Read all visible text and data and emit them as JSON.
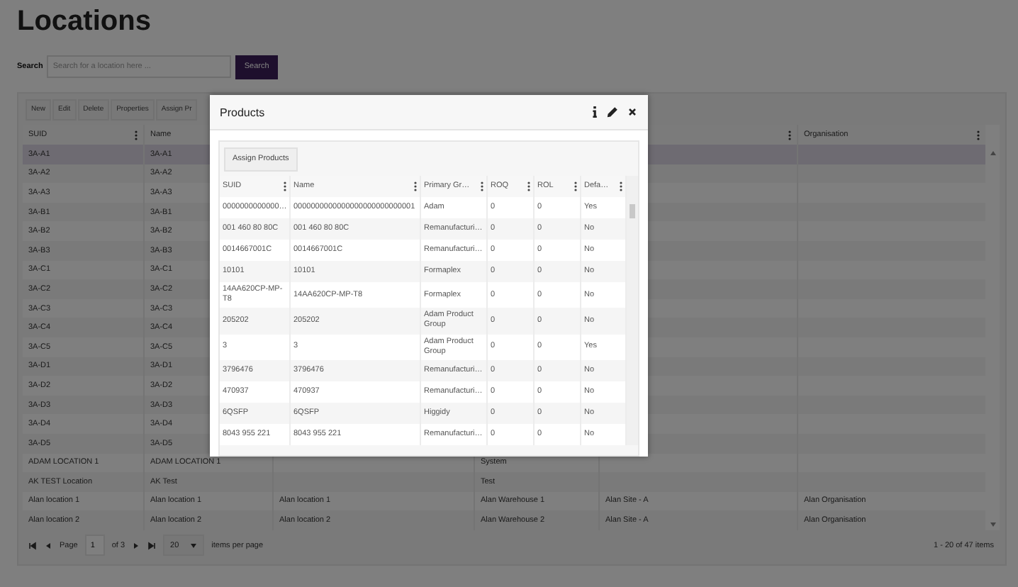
{
  "page": {
    "title": "Locations"
  },
  "search": {
    "label": "Search",
    "placeholder": "Search for a location here ...",
    "button": "Search"
  },
  "toolbar": [
    "New",
    "Edit",
    "Delete",
    "Properties",
    "Assign Pr"
  ],
  "grid": {
    "columns": [
      {
        "label": "SUID",
        "menu": true
      },
      {
        "label": "Name"
      },
      {},
      {},
      {
        "menu": true
      },
      {
        "label": "Organisation",
        "menu": true
      }
    ],
    "rows": [
      {
        "selected": true,
        "cells": [
          "3A-A1",
          "3A-A1",
          null,
          null,
          null,
          null
        ]
      },
      {
        "selected": false,
        "cells": [
          "3A-A2",
          "3A-A2",
          null,
          null,
          null,
          null
        ]
      },
      {
        "selected": false,
        "cells": [
          "3A-A3",
          "3A-A3",
          null,
          null,
          null,
          null
        ]
      },
      {
        "selected": false,
        "cells": [
          "3A-B1",
          "3A-B1",
          null,
          null,
          null,
          null
        ]
      },
      {
        "selected": false,
        "cells": [
          "3A-B2",
          "3A-B2",
          null,
          null,
          null,
          null
        ]
      },
      {
        "selected": false,
        "cells": [
          "3A-B3",
          "3A-B3",
          null,
          null,
          null,
          null
        ]
      },
      {
        "selected": false,
        "cells": [
          "3A-C1",
          "3A-C1",
          null,
          null,
          null,
          null
        ]
      },
      {
        "selected": false,
        "cells": [
          "3A-C2",
          "3A-C2",
          null,
          null,
          null,
          null
        ]
      },
      {
        "selected": false,
        "cells": [
          "3A-C3",
          "3A-C3",
          null,
          null,
          null,
          null
        ]
      },
      {
        "selected": false,
        "cells": [
          "3A-C4",
          "3A-C4",
          null,
          null,
          null,
          null
        ]
      },
      {
        "selected": false,
        "cells": [
          "3A-C5",
          "3A-C5",
          null,
          null,
          null,
          null
        ]
      },
      {
        "selected": false,
        "cells": [
          "3A-D1",
          "3A-D1",
          null,
          null,
          null,
          null
        ]
      },
      {
        "selected": false,
        "cells": [
          "3A-D2",
          "3A-D2",
          null,
          null,
          null,
          null
        ]
      },
      {
        "selected": false,
        "cells": [
          "3A-D3",
          "3A-D3",
          null,
          null,
          null,
          null
        ]
      },
      {
        "selected": false,
        "cells": [
          "3A-D4",
          "3A-D4",
          null,
          null,
          null,
          null
        ]
      },
      {
        "selected": false,
        "cells": [
          "3A-D5",
          "3A-D5",
          null,
          null,
          null,
          null
        ]
      },
      {
        "selected": false,
        "cells": [
          "ADAM LOCATION 1",
          "ADAM LOCATION 1",
          null,
          "System",
          null,
          null
        ]
      },
      {
        "selected": false,
        "cells": [
          "AK TEST Location",
          "AK Test",
          null,
          "Test",
          null,
          null
        ]
      },
      {
        "selected": false,
        "cells": [
          "Alan location 1",
          "Alan location 1",
          "Alan location 1",
          "Alan Warehouse 1",
          "Alan Site - A",
          "Alan Organisation"
        ]
      },
      {
        "selected": false,
        "cells": [
          "Alan location 2",
          "Alan location 2",
          "Alan location 2",
          "Alan Warehouse 2",
          "Alan Site - A",
          "Alan Organisation"
        ]
      }
    ]
  },
  "pager": {
    "page_label": "Page",
    "page": "1",
    "of": "of 3",
    "page_size": "20",
    "per_page": "items per page",
    "summary": "1 - 20 of 47 items"
  },
  "modal": {
    "title": "Products",
    "assign_button": "Assign Products",
    "columns": [
      "SUID",
      "Name",
      "Primary Gr…",
      "ROQ",
      "ROL",
      "Defa…"
    ],
    "rows": [
      [
        "0000000000000…",
        "0000000000000000000000000001",
        "Adam",
        "0",
        "0",
        "Yes"
      ],
      [
        "001 460 80 80C",
        "001 460 80 80C",
        "Remanufacturi…",
        "0",
        "0",
        "No"
      ],
      [
        "0014667001C",
        "0014667001C",
        "Remanufacturi…",
        "0",
        "0",
        "No"
      ],
      [
        "10101",
        "10101",
        "Formaplex",
        "0",
        "0",
        "No"
      ],
      [
        "14AA620CP-MP-T8",
        "14AA620CP-MP-T8",
        "Formaplex",
        "0",
        "0",
        "No"
      ],
      [
        "205202",
        "205202",
        "Adam Product Group",
        "0",
        "0",
        "No"
      ],
      [
        "3",
        "3",
        "Adam Product Group",
        "0",
        "0",
        "Yes"
      ],
      [
        "3796476",
        "3796476",
        "Remanufacturi…",
        "0",
        "0",
        "No"
      ],
      [
        "470937",
        "470937",
        "Remanufacturi…",
        "0",
        "0",
        "No"
      ],
      [
        "6QSFP",
        "6QSFP",
        "Higgidy",
        "0",
        "0",
        "No"
      ],
      [
        "8043 955 221",
        "8043 955 221",
        "Remanufacturi…",
        "0",
        "0",
        "No"
      ]
    ]
  }
}
